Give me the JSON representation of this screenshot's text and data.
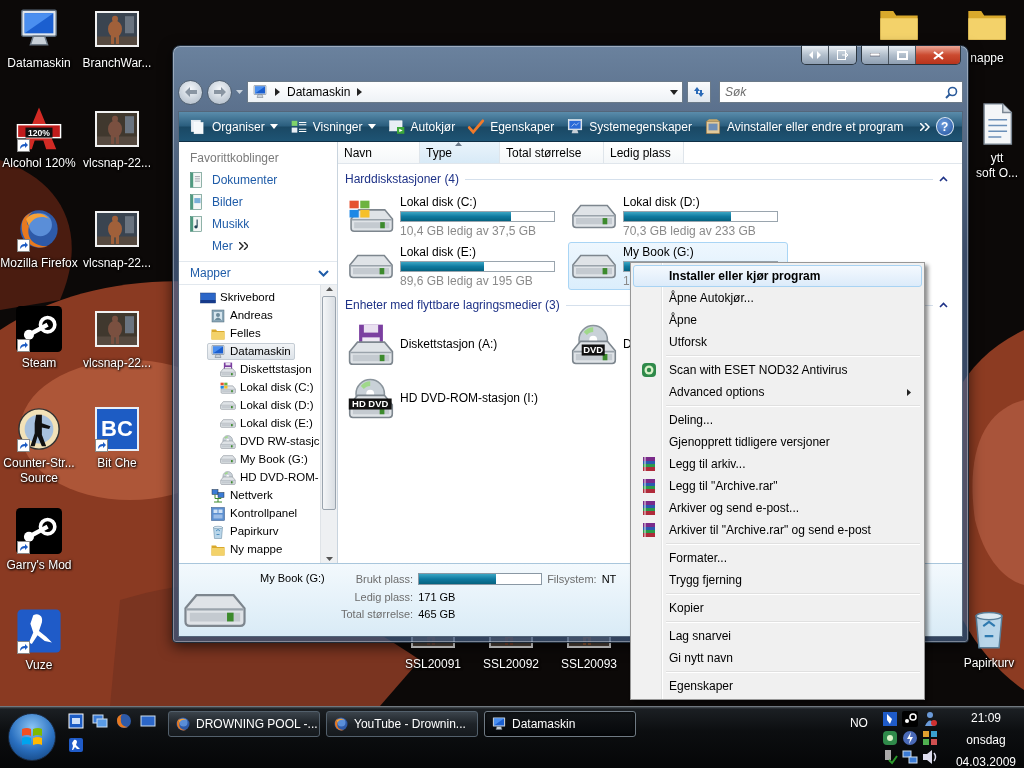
{
  "desktop": {
    "icons": [
      {
        "label": "Datamaskin",
        "kind": "computer",
        "shortcut": false
      },
      {
        "label": "BranchWar...",
        "kind": "picture",
        "shortcut": false
      },
      {
        "label": "Alcohol 120%",
        "kind": "alcohol",
        "badge": "120%",
        "shortcut": true
      },
      {
        "label": "vlcsnap-22...",
        "kind": "picture",
        "shortcut": false
      },
      {
        "label": "Mozilla Firefox",
        "kind": "firefox",
        "shortcut": true
      },
      {
        "label": "vlcsnap-22...",
        "kind": "picture",
        "shortcut": false
      },
      {
        "label": "Steam",
        "kind": "steam",
        "shortcut": true
      },
      {
        "label": "vlcsnap-22...",
        "kind": "picture",
        "shortcut": false
      },
      {
        "label": "Counter-Str...\nSource",
        "kind": "cs",
        "shortcut": true
      },
      {
        "label": "Bit Che",
        "kind": "bitche",
        "badge": "BC",
        "shortcut": true
      },
      {
        "label": "Garry's Mod",
        "kind": "steam",
        "shortcut": true
      },
      {
        "label": "Vuze",
        "kind": "vuze",
        "shortcut": true
      },
      {
        "kind": "folder",
        "shortcut": false
      },
      {
        "label": "nappe",
        "kind": "folder",
        "shortcut": false
      },
      {
        "label": "ytt\nsoft O...",
        "kind": "document",
        "shortcut": false
      },
      {
        "label": "SSL20091",
        "kind": "picture",
        "shortcut": false
      },
      {
        "label": "SSL20092",
        "kind": "picture",
        "shortcut": false
      },
      {
        "label": "SSL20093",
        "kind": "picture",
        "shortcut": false
      },
      {
        "label": "Papirkurv",
        "kind": "recycle",
        "shortcut": false
      }
    ]
  },
  "window": {
    "address": {
      "crumbs": [
        "Datamaskin"
      ]
    },
    "search": {
      "placeholder": "Søk"
    },
    "toolbar": {
      "buttons": [
        {
          "label": "Organiser",
          "kind": "organize",
          "dropdown": true
        },
        {
          "label": "Visninger",
          "kind": "views",
          "dropdown": true
        },
        {
          "label": "Autokjør",
          "kind": "autoplay",
          "dropdown": false
        },
        {
          "label": "Egenskaper",
          "kind": "properties",
          "dropdown": false
        },
        {
          "label": "Systemegenskaper",
          "kind": "system",
          "dropdown": false
        },
        {
          "label": "Avinstaller eller endre et program",
          "kind": "uninstall",
          "dropdown": false
        }
      ],
      "help": "?"
    },
    "nav_pane": {
      "favorites_title": "Favorittkoblinger",
      "favorites": [
        {
          "label": "Dokumenter",
          "kind": "documents"
        },
        {
          "label": "Bilder",
          "kind": "pictures"
        },
        {
          "label": "Musikk",
          "kind": "music"
        }
      ],
      "more": "Mer",
      "folders_title": "Mapper",
      "tree": [
        {
          "label": "Skrivebord",
          "kind": "desktop",
          "selected": false,
          "children": [
            {
              "label": "Andreas",
              "kind": "user",
              "selected": false
            },
            {
              "label": "Felles",
              "kind": "folder",
              "selected": false
            },
            {
              "label": "Datamaskin",
              "kind": "computer",
              "selected": true,
              "children": [
                {
                  "label": "Diskettstasjon",
                  "kind": "floppy",
                  "selected": false
                },
                {
                  "label": "Lokal disk (C:)",
                  "kind": "system-disk",
                  "selected": false
                },
                {
                  "label": "Lokal disk (D:)",
                  "kind": "disk",
                  "selected": false
                },
                {
                  "label": "Lokal disk (E:)",
                  "kind": "disk",
                  "selected": false
                },
                {
                  "label": "DVD RW-stasjc",
                  "kind": "dvd",
                  "selected": false
                },
                {
                  "label": "My Book (G:)",
                  "kind": "disk",
                  "selected": false
                },
                {
                  "label": "HD DVD-ROM-",
                  "kind": "dvd",
                  "selected": false
                }
              ]
            },
            {
              "label": "Nettverk",
              "kind": "network",
              "selected": false
            },
            {
              "label": "Kontrollpanel",
              "kind": "control-panel",
              "selected": false
            },
            {
              "label": "Papirkurv",
              "kind": "recycle",
              "selected": false
            },
            {
              "label": "Ny mappe",
              "kind": "folder",
              "selected": false
            }
          ]
        }
      ]
    },
    "columns": [
      {
        "label": "Navn",
        "sorted": false
      },
      {
        "label": "Type",
        "sorted": true
      },
      {
        "label": "Total størrelse",
        "sorted": false
      },
      {
        "label": "Ledig plass",
        "sorted": false
      }
    ],
    "groups": [
      {
        "title": "Harddiskstasjoner (4)",
        "items": [
          {
            "name": "Lokal disk (C:)",
            "kind": "system-disk",
            "level": 0.72,
            "free": "10,4 GB ledig av 37,5 GB",
            "selected": false
          },
          {
            "name": "Lokal disk (D:)",
            "kind": "disk",
            "level": 0.7,
            "free": "70,3 GB ledig av 233 GB",
            "selected": false
          },
          {
            "name": "Lokal disk (E:)",
            "kind": "disk",
            "level": 0.54,
            "free": "89,6 GB ledig av 195 GB",
            "selected": false
          },
          {
            "name": "My Book (G:)",
            "kind": "disk",
            "level": 0.63,
            "free": "1",
            "selected": true
          }
        ]
      },
      {
        "title": "Enheter med flyttbare lagringsmedier (3)",
        "items": [
          {
            "name": "Diskettstasjon (A:)",
            "kind": "floppy",
            "selected": false
          },
          {
            "name": "D",
            "kind": "dvd",
            "badge": "DVD",
            "selected": false
          },
          {
            "name": "HD DVD-ROM-stasjon (I:)",
            "kind": "dvd",
            "badge": "HD DVD",
            "selected": false
          }
        ]
      }
    ],
    "details": {
      "name": "My Book (G:)",
      "rows": [
        [
          {
            "label": "Brukt plass:",
            "kind": "bar",
            "level": 0.63
          },
          {
            "label": "Filsystem:",
            "kind": "text",
            "value": "NT"
          }
        ],
        [
          {
            "label": "Ledig plass:",
            "kind": "text",
            "value": "171 GB"
          }
        ],
        [
          {
            "label": "Total størrelse:",
            "kind": "text",
            "value": "465 GB"
          }
        ]
      ]
    }
  },
  "context_menu": {
    "sections": [
      {
        "items": [
          {
            "label": "Installer eller kjør program",
            "kind": "plain",
            "default": true,
            "selected": true,
            "submenu": false
          },
          {
            "label": "Åpne Autokjør...",
            "kind": "plain",
            "default": false,
            "selected": false,
            "submenu": false
          },
          {
            "label": "Åpne",
            "kind": "plain",
            "default": false,
            "selected": false,
            "submenu": false
          },
          {
            "label": "Utforsk",
            "kind": "plain",
            "default": false,
            "selected": false,
            "submenu": false
          }
        ]
      },
      {
        "items": [
          {
            "label": "Scan with ESET NOD32 Antivirus",
            "kind": "eset",
            "default": false,
            "selected": false,
            "submenu": false
          },
          {
            "label": "Advanced options",
            "kind": "plain",
            "default": false,
            "selected": false,
            "submenu": true
          }
        ]
      },
      {
        "items": [
          {
            "label": "Deling...",
            "kind": "plain",
            "default": false,
            "selected": false,
            "submenu": false
          },
          {
            "label": "Gjenopprett tidligere versjoner",
            "kind": "plain",
            "default": false,
            "selected": false,
            "submenu": false
          },
          {
            "label": "Legg til arkiv...",
            "kind": "rar",
            "default": false,
            "selected": false,
            "submenu": false
          },
          {
            "label": "Legg til \"Archive.rar\"",
            "kind": "rar",
            "default": false,
            "selected": false,
            "submenu": false
          },
          {
            "label": "Arkiver og send e-post...",
            "kind": "rar",
            "default": false,
            "selected": false,
            "submenu": false
          },
          {
            "label": "Arkiver til \"Archive.rar\" og send e-post",
            "kind": "rar",
            "default": false,
            "selected": false,
            "submenu": false
          }
        ]
      },
      {
        "items": [
          {
            "label": "Formater...",
            "kind": "plain",
            "default": false,
            "selected": false,
            "submenu": false
          },
          {
            "label": "Trygg fjerning",
            "kind": "plain",
            "default": false,
            "selected": false,
            "submenu": false
          }
        ]
      },
      {
        "items": [
          {
            "label": "Kopier",
            "kind": "plain",
            "default": false,
            "selected": false,
            "submenu": false
          }
        ]
      },
      {
        "items": [
          {
            "label": "Lag snarvei",
            "kind": "plain",
            "default": false,
            "selected": false,
            "submenu": false
          },
          {
            "label": "Gi nytt navn",
            "kind": "plain",
            "default": false,
            "selected": false,
            "submenu": false
          }
        ]
      },
      {
        "items": [
          {
            "label": "Egenskaper",
            "kind": "plain",
            "default": false,
            "selected": false,
            "submenu": false
          }
        ]
      }
    ]
  },
  "taskbar": {
    "tasks": [
      {
        "label": "DROWNING POOL -...",
        "kind": "firefox",
        "selected": false
      },
      {
        "label": "YouTube - Drownin...",
        "kind": "firefox",
        "selected": false
      },
      {
        "label": "Datamaskin",
        "kind": "computer",
        "selected": true
      }
    ],
    "language": "NO",
    "time": "21:09",
    "day": "onsdag",
    "date": "04.03.2009"
  }
}
